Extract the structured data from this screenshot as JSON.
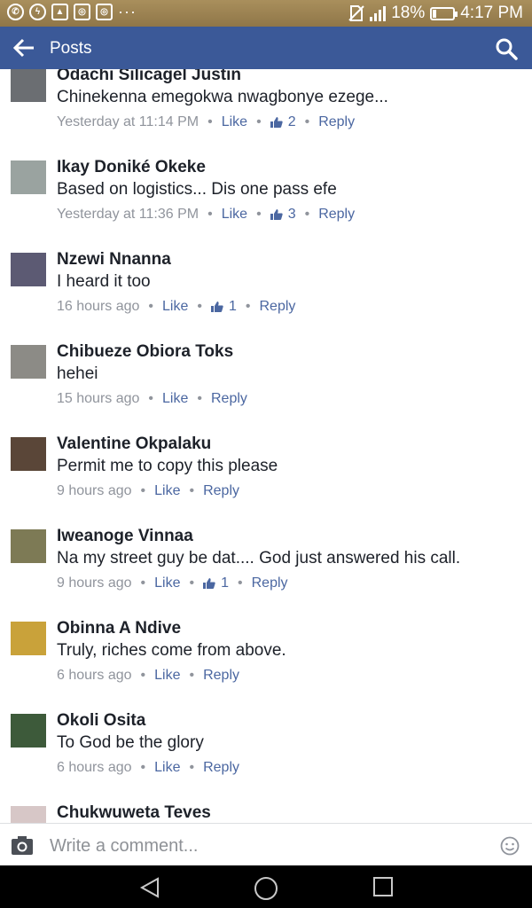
{
  "status": {
    "battery": "18%",
    "time": "4:17 PM",
    "battery_level": 0.18
  },
  "header": {
    "title": "Posts"
  },
  "comments": [
    {
      "name": "Odachi Silicagel Justin",
      "text": "Chinekenna emegokwa nwagbonye ezege...",
      "time": "Yesterday at 11:14 PM",
      "likes": "2",
      "avatar_color": "#6b6e72"
    },
    {
      "name": "Ikay Doniké Okeke",
      "text": "Based on logistics... Dis one pass efe",
      "time": "Yesterday at 11:36 PM",
      "likes": "3",
      "avatar_color": "#9aa3a0"
    },
    {
      "name": "Nzewi Nnanna",
      "text": "I heard it too",
      "time": "16 hours ago",
      "likes": "1",
      "avatar_color": "#5c5a73"
    },
    {
      "name": "Chibueze Obiora Toks",
      "text": "hehei",
      "time": "15 hours ago",
      "likes": "",
      "avatar_color": "#8c8b86"
    },
    {
      "name": "Valentine Okpalaku",
      "text": "Permit me to copy this please",
      "time": "9 hours ago",
      "likes": "",
      "avatar_color": "#5a4638"
    },
    {
      "name": "Iweanoge Vinnaa",
      "text": "Na my street guy be dat.... God just answered his call.",
      "time": "9 hours ago",
      "likes": "1",
      "avatar_color": "#7d7a55"
    },
    {
      "name": "Obinna A Ndive",
      "text": "Truly, riches come from above.",
      "time": "6 hours ago",
      "likes": "",
      "avatar_color": "#c9a23a"
    },
    {
      "name": "Okoli Osita",
      "text": "To God be the glory",
      "time": "6 hours ago",
      "likes": "",
      "avatar_color": "#3d5a3a"
    },
    {
      "name": "Chukwuweta Teves",
      "text": "",
      "time": "",
      "likes": "",
      "avatar_color": "#d7c7c7"
    }
  ],
  "labels": {
    "like": "Like",
    "reply": "Reply",
    "dot": "•"
  },
  "composer": {
    "placeholder": "Write a comment..."
  },
  "colors": {
    "header": "#3b5998",
    "link": "#4b67a1",
    "meta": "#90949c",
    "status_bar": "#a98f5c"
  },
  "icons": [
    "whatsapp-icon",
    "messenger-icon",
    "gallery-icon",
    "instagram-icon",
    "more-icon",
    "no-sim-icon",
    "signal-icon",
    "battery-icon",
    "back-arrow-icon",
    "search-icon",
    "thumbs-up-icon",
    "camera-icon",
    "emoji-icon",
    "nav-back-icon",
    "nav-home-icon",
    "nav-recents-icon"
  ]
}
